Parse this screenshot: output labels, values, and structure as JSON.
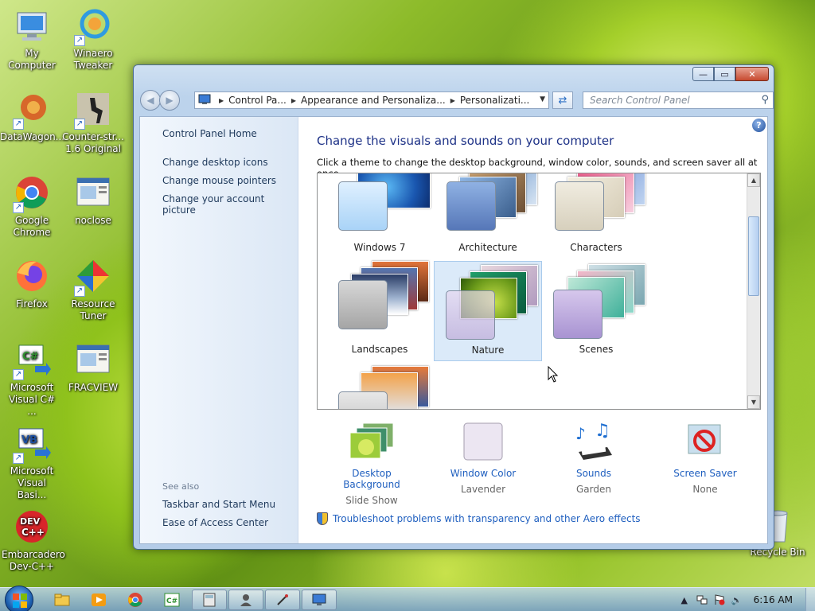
{
  "desktop": {
    "icons": [
      {
        "label": "My Computer",
        "icon": "computer-icon"
      },
      {
        "label": "Winaero Tweaker",
        "icon": "winaero-icon"
      },
      {
        "label": "DataWagon...",
        "icon": "datawagon-icon"
      },
      {
        "label": "Counter-str... 1.6 Original",
        "icon": "counter-strike-icon"
      },
      {
        "label": "Google Chrome",
        "icon": "chrome-icon"
      },
      {
        "label": "noclose",
        "icon": "app-window-icon"
      },
      {
        "label": "Firefox",
        "icon": "firefox-icon"
      },
      {
        "label": "Resource Tuner",
        "icon": "resource-tuner-icon"
      },
      {
        "label": "Microsoft Visual C# ...",
        "icon": "visual-csharp-icon"
      },
      {
        "label": "FRACVIEW",
        "icon": "app-window-icon"
      },
      {
        "label": "Microsoft Visual Basi...",
        "icon": "visual-basic-icon"
      },
      {
        "label": "Embarcadero Dev-C++",
        "icon": "devcpp-icon"
      },
      {
        "label": "Recycle Bin",
        "icon": "recycle-bin-icon"
      }
    ]
  },
  "window": {
    "controls": {
      "minimize": "—",
      "maximize": "▭",
      "close": "✕"
    },
    "address": {
      "crumbs": [
        "Control Pa...",
        "Appearance and Personaliza...",
        "Personalizati..."
      ]
    },
    "search": {
      "placeholder": "Search Control Panel"
    },
    "left": {
      "home": "Control Panel Home",
      "links": [
        "Change desktop icons",
        "Change mouse pointers",
        "Change your account picture"
      ],
      "see_also": "See also",
      "see_also_links": [
        "Taskbar and Start Menu",
        "Ease of Access Center"
      ]
    },
    "main": {
      "title": "Change the visuals and sounds on your computer",
      "description": "Click a theme to change the desktop background, window color, sounds, and screen saver all at once.",
      "themes": [
        {
          "label": "Windows 7",
          "selected": false
        },
        {
          "label": "Architecture",
          "selected": false
        },
        {
          "label": "Characters",
          "selected": false
        },
        {
          "label": "Landscapes",
          "selected": false
        },
        {
          "label": "Nature",
          "selected": true
        },
        {
          "label": "Scenes",
          "selected": false
        }
      ],
      "options": [
        {
          "title": "Desktop Background",
          "value": "Slide Show",
          "icon": "desktop-background-icon"
        },
        {
          "title": "Window Color",
          "value": "Lavender",
          "icon": "window-color-icon"
        },
        {
          "title": "Sounds",
          "value": "Garden",
          "icon": "sounds-icon"
        },
        {
          "title": "Screen Saver",
          "value": "None",
          "icon": "screen-saver-icon"
        }
      ],
      "troubleshoot": "Troubleshoot problems with transparency and other Aero effects"
    }
  },
  "taskbar": {
    "clock": "6:16 AM"
  }
}
